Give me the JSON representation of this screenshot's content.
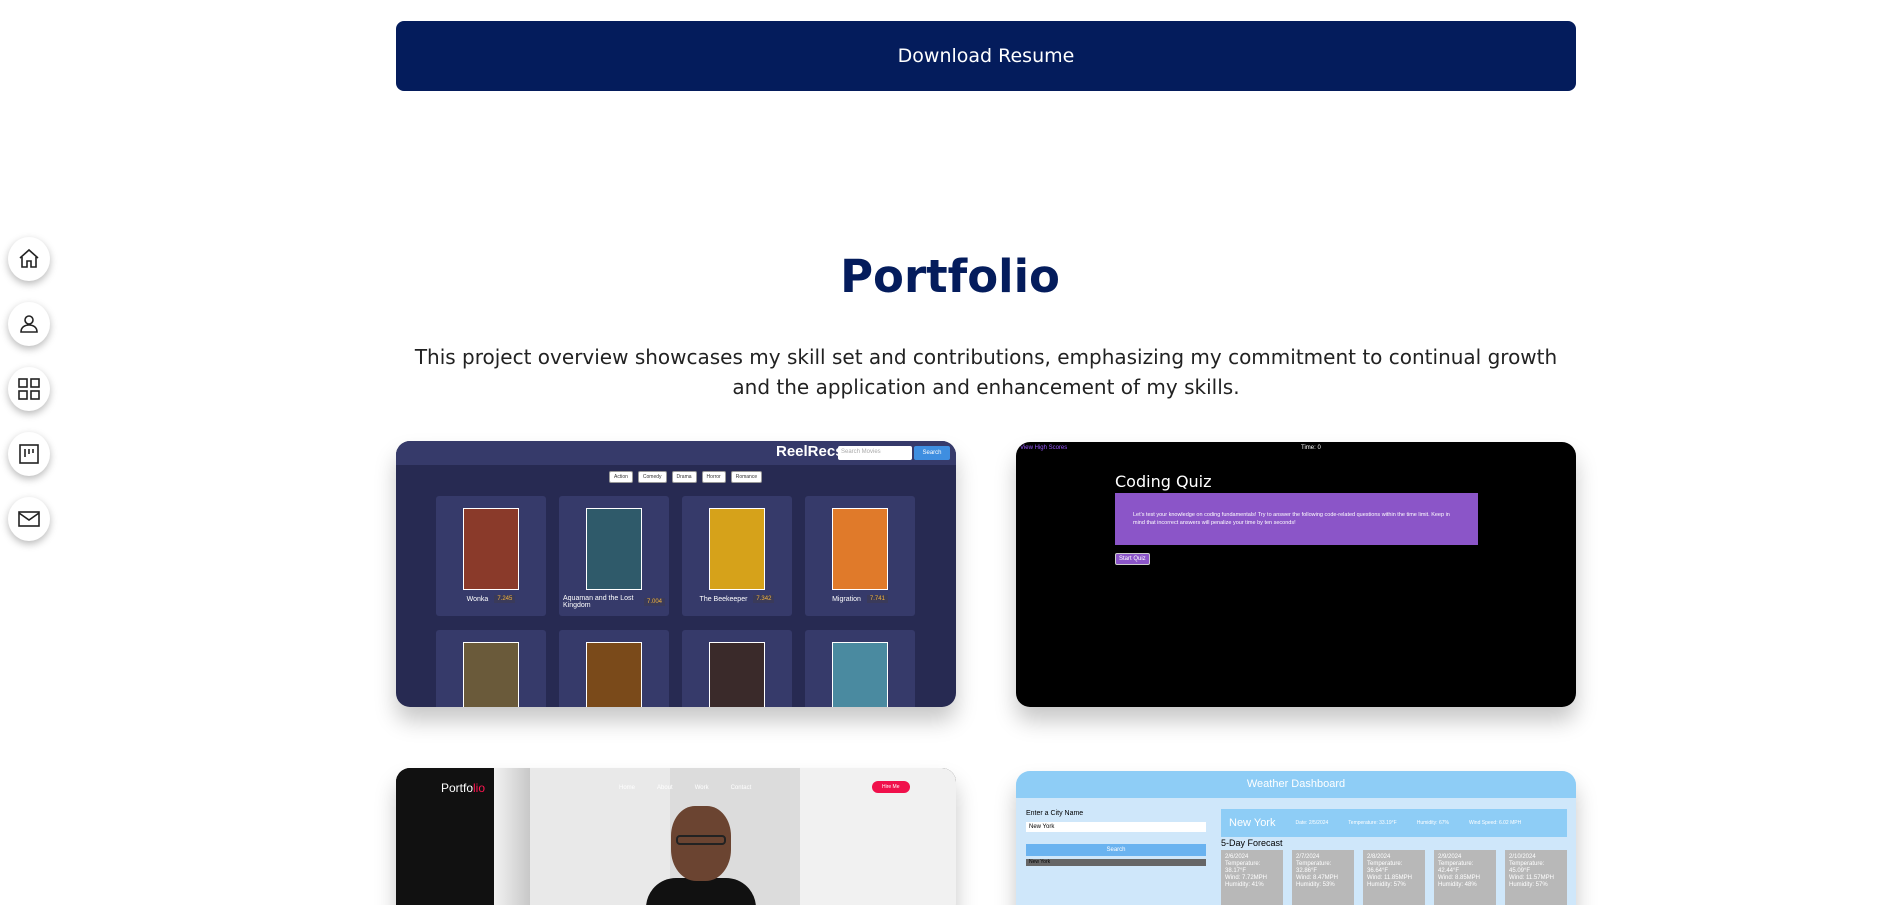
{
  "download_button": "Download Resume",
  "sidenav": [
    {
      "name": "home-icon"
    },
    {
      "name": "user-icon"
    },
    {
      "name": "grid-icon"
    },
    {
      "name": "board-icon"
    },
    {
      "name": "mail-icon"
    }
  ],
  "portfolio": {
    "title": "Portfolio",
    "description": "This project overview showcases my skill set and contributions, emphasizing my commitment to continual growth and the application and enhancement of my skills."
  },
  "reel": {
    "logo": "ReelRecs",
    "search_placeholder": "Search Movies",
    "search_button": "Search",
    "genres": [
      "Action",
      "Comedy",
      "Drama",
      "Horror",
      "Romance"
    ],
    "movies": [
      {
        "title": "Wonka",
        "rating": "7.245",
        "color": "#8a3a2a"
      },
      {
        "title": "Aquaman and the Lost Kingdom",
        "rating": "7.004",
        "color": "#2f5a6a"
      },
      {
        "title": "The Beekeeper",
        "rating": "7.342",
        "color": "#d6a21a"
      },
      {
        "title": "Migration",
        "rating": "7.741",
        "color": "#e07a2a"
      },
      {
        "title": "",
        "rating": "",
        "color": "#6a5a3a"
      },
      {
        "title": "",
        "rating": "",
        "color": "#7a4a1a"
      },
      {
        "title": "",
        "rating": "",
        "color": "#3a2a2a"
      },
      {
        "title": "",
        "rating": "",
        "color": "#4a8aa0"
      }
    ]
  },
  "quiz": {
    "high_scores": "View High Scores",
    "time": "Time: 0",
    "title": "Coding Quiz",
    "intro": "Let's test your knowledge on coding fundamentals! Try to answer the following code-related questions within the time limit. Keep in mind that incorrect answers will penalize your time by ten seconds!",
    "start": "Start Quiz"
  },
  "port": {
    "logo_main": "Portfo",
    "logo_accent": "lio",
    "nav": [
      "Home",
      "About",
      "Work",
      "Contact"
    ],
    "hire": "Hire Me"
  },
  "weather": {
    "header": "Weather Dashboard",
    "city_label": "Enter a City Name",
    "city_value": "New York",
    "search_button": "Search",
    "history_item": "New York",
    "current": {
      "city": "New York",
      "date": "Date: 2/5/2024",
      "temp": "Temperature: 33.19°F",
      "humidity": "Humidity: 67%",
      "wind": "Wind Speed: 6.02 MPH"
    },
    "forecast_label": "5-Day Forecast",
    "days": [
      {
        "date": "2/6/2024",
        "temp": "Temperature: 38.17°F",
        "wind": "Wind: 7.72MPH",
        "humidity": "Humidity: 41%"
      },
      {
        "date": "2/7/2024",
        "temp": "Temperature: 32.86°F",
        "wind": "Wind: 8.47MPH",
        "humidity": "Humidity: 53%"
      },
      {
        "date": "2/8/2024",
        "temp": "Temperature: 36.64°F",
        "wind": "Wind: 11.85MPH",
        "humidity": "Humidity: 57%"
      },
      {
        "date": "2/9/2024",
        "temp": "Temperature: 42.44°F",
        "wind": "Wind: 8.85MPH",
        "humidity": "Humidity: 48%"
      },
      {
        "date": "2/10/2024",
        "temp": "Temperature: 45.09°F",
        "wind": "Wind: 11.57MPH",
        "humidity": "Humidity: 57%"
      }
    ]
  }
}
